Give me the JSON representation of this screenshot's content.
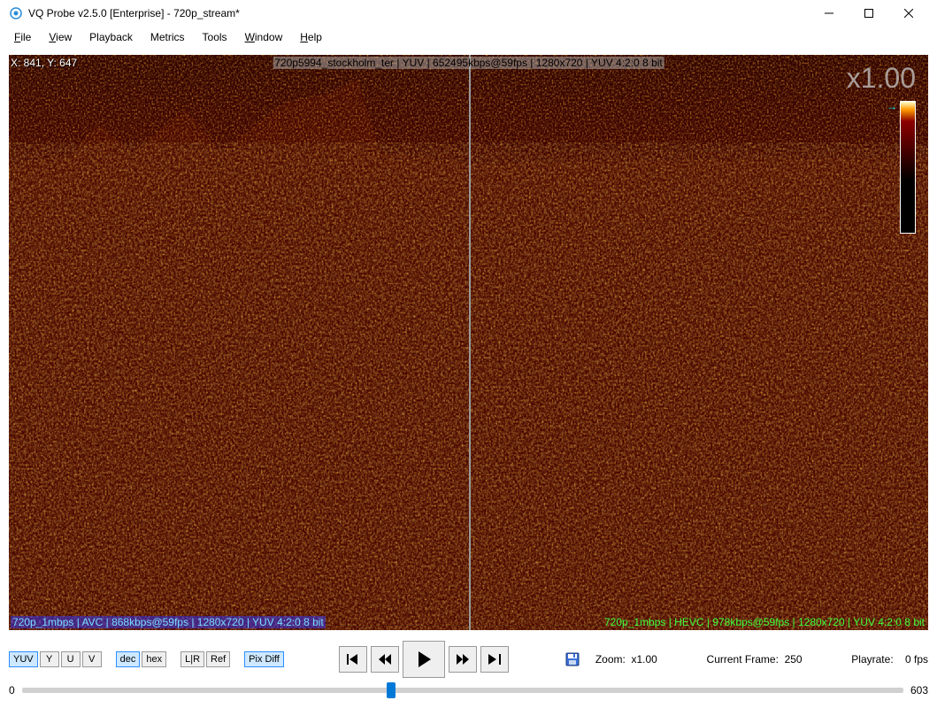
{
  "window": {
    "title": "VQ Probe v2.5.0 [Enterprise] - 720p_stream*"
  },
  "menu": {
    "file": "File",
    "view": "View",
    "playback": "Playback",
    "metrics": "Metrics",
    "tools": "Tools",
    "window": "Window",
    "help": "Help"
  },
  "viewport": {
    "coord": "X: 841, Y: 647",
    "top_info": "720p5994_stockholm_ter | YUV | 652495kbps@59fps | 1280x720 | YUV 4:2:0 8 bit",
    "zoom_overlay": "x1.00",
    "bottom_left": "720p_1mbps | AVC | 868kbps@59fps | 1280x720 | YUV 4:2:0 8 bit",
    "bottom_right": "720p_1mbps | HEVC | 978kbps@59fps | 1280x720 | YUV 4:2:0 8 bit"
  },
  "controls": {
    "yuv": "YUV",
    "y": "Y",
    "u": "U",
    "v": "V",
    "dec": "dec",
    "hex": "hex",
    "lr": "L|R",
    "ref": "Ref",
    "pixdiff": "Pix Diff",
    "zoom_label": "Zoom:",
    "zoom_value": "x1.00",
    "frame_label": "Current Frame:",
    "frame_value": "250",
    "playrate_label": "Playrate:",
    "playrate_value": "0 fps"
  },
  "timeline": {
    "start": "0",
    "end": "603",
    "current": 250
  }
}
